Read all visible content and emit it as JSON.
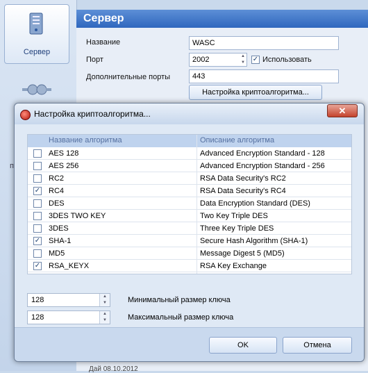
{
  "sidebar": {
    "server_label": "Сервер",
    "partial_label": "п"
  },
  "panel": {
    "title": "Сервер",
    "name_label": "Название",
    "name_value": "WASC",
    "port_label": "Порт",
    "port_value": "2002",
    "use_label": "Использовать",
    "extra_ports_label": "Дополнительные порты",
    "extra_ports_value": "443",
    "crypto_button": "Настройка криптоалгоритма...",
    "bottom_partial": "Дай                 08.10.2012"
  },
  "dialog": {
    "title": "Настройка криптоалгоритма...",
    "close_symbol": "✕",
    "col_name": "Название алгоритма",
    "col_desc": "Описание алгоритма",
    "rows": [
      {
        "name": "AES 128",
        "desc": "Advanced Encryption Standard - 128",
        "checked": false
      },
      {
        "name": "AES 256",
        "desc": "Advanced Encryption Standard - 256",
        "checked": false
      },
      {
        "name": "RC2",
        "desc": "RSA Data Security's RC2",
        "checked": false
      },
      {
        "name": "RC4",
        "desc": "RSA Data Security's RC4",
        "checked": true
      },
      {
        "name": "DES",
        "desc": "Data Encryption Standard (DES)",
        "checked": false
      },
      {
        "name": "3DES TWO KEY",
        "desc": "Two Key Triple DES",
        "checked": false
      },
      {
        "name": "3DES",
        "desc": "Three Key Triple DES",
        "checked": false
      },
      {
        "name": "SHA-1",
        "desc": "Secure Hash Algorithm (SHA-1)",
        "checked": true
      },
      {
        "name": "MD5",
        "desc": "Message Digest 5 (MD5)",
        "checked": false
      },
      {
        "name": "RSA_KEYX",
        "desc": "RSA Key Exchange",
        "checked": true
      }
    ],
    "min_key_value": "128",
    "min_key_label": "Минимальный размер ключа",
    "max_key_value": "128",
    "max_key_label": "Максимальный размер ключа",
    "ok_label": "OK",
    "cancel_label": "Отмена"
  }
}
